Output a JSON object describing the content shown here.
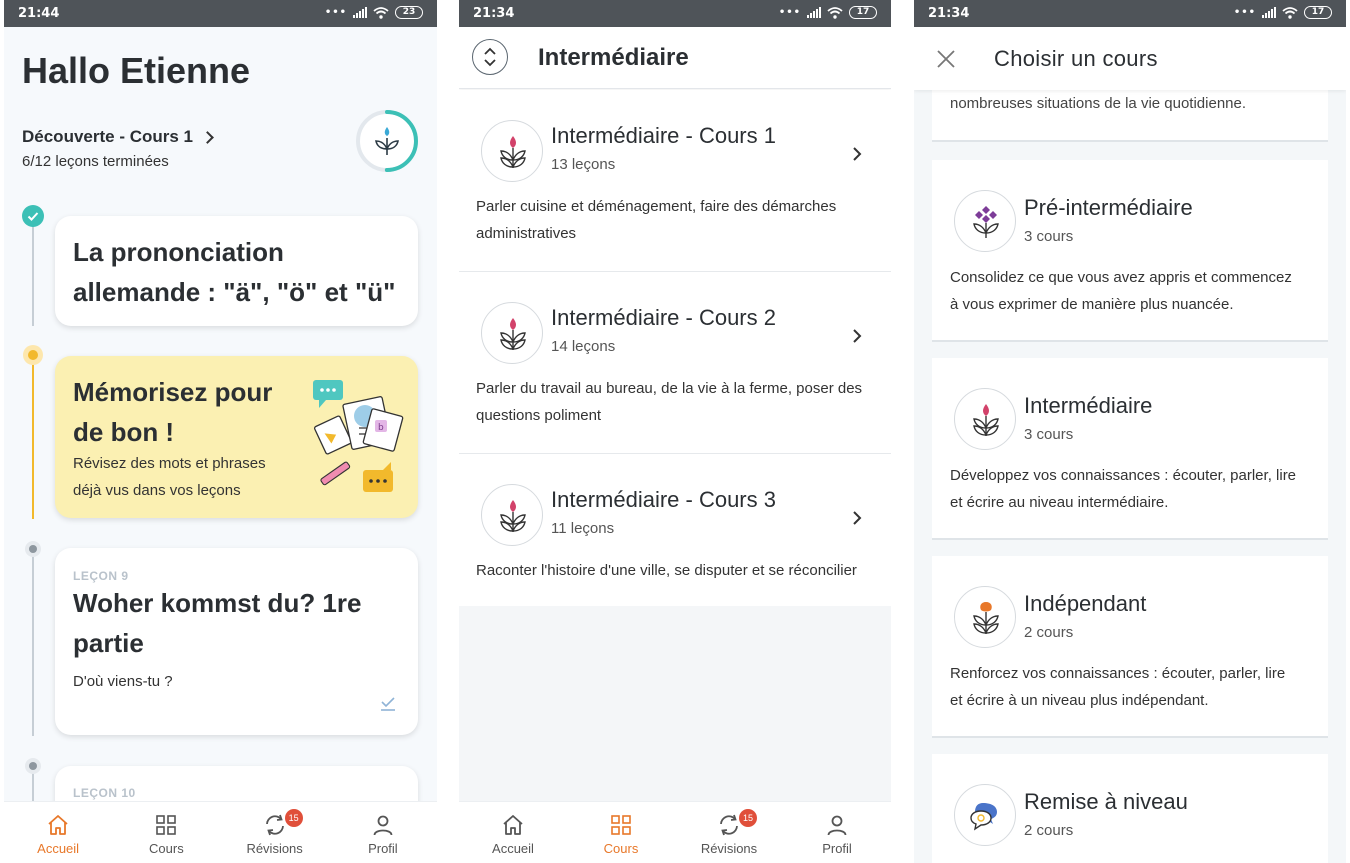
{
  "screen1": {
    "status": {
      "time": "21:44",
      "battery": "23"
    },
    "greeting": "Hallo Etienne",
    "course": {
      "name": "Découverte - Cours 1",
      "progress": "6/12 leçons terminées",
      "fraction": 0.5
    },
    "cards": [
      {
        "title_line1": "La prononciation",
        "title_line2": "allemande : \"ä\", \"ö\" et \"ü\""
      },
      {
        "title_line1": "Mémorisez pour",
        "title_line2": "de bon !",
        "sub_line1": "Révisez des mots et phrases",
        "sub_line2": "déjà vus dans vos leçons"
      },
      {
        "kicker": "LEÇON 9",
        "title_line1": "Woher kommst du? 1re",
        "title_line2": "partie",
        "sub": "D'où viens-tu ?"
      },
      {
        "kicker": "LEÇON 10"
      }
    ]
  },
  "screen2": {
    "status": {
      "time": "21:34",
      "battery": "17"
    },
    "title": "Intermédiaire",
    "courses": [
      {
        "title": "Intermédiaire - Cours 1",
        "count": "13 leçons",
        "desc_line1": "Parler cuisine et déménagement, faire des démarches",
        "desc_line2": "administratives"
      },
      {
        "title": "Intermédiaire - Cours 2",
        "count": "14 leçons",
        "desc_line1": "Parler du travail au bureau, de la vie à la ferme, poser des",
        "desc_line2": "questions poliment"
      },
      {
        "title": "Intermédiaire - Cours 3",
        "count": "11 leçons",
        "desc_line1": "Raconter l'histoire d'une ville, se disputer et se réconcilier",
        "desc_line2": ""
      }
    ]
  },
  "screen3": {
    "status": {
      "time": "21:34",
      "battery": "17"
    },
    "title": "Choisir un cours",
    "prev_tail": "nombreuses situations de la vie quotidienne.",
    "levels": [
      {
        "title": "Pré-intermédiaire",
        "count": "3 cours",
        "desc_line1": "Consolidez ce que vous avez appris et commencez",
        "desc_line2": "à vous exprimer de manière plus nuancée."
      },
      {
        "title": "Intermédiaire",
        "count": "3 cours",
        "desc_line1": "Développez vos connaissances : écouter, parler, lire",
        "desc_line2": "et écrire au niveau intermédiaire."
      },
      {
        "title": "Indépendant",
        "count": "2 cours",
        "desc_line1": "Renforcez vos connaissances : écouter, parler, lire",
        "desc_line2": "et écrire à un niveau plus indépendant."
      },
      {
        "title": "Remise à niveau",
        "count": "2 cours"
      }
    ]
  },
  "nav": {
    "home": "Accueil",
    "courses": "Cours",
    "reviews": "Révisions",
    "profile": "Profil",
    "badge": "15"
  },
  "colors": {
    "accent_orange": "#e8782a",
    "teal": "#3cc0b6",
    "yellow_card": "#fbf0b2",
    "status_bar": "#4f5459",
    "badge_red": "#e04f3a"
  }
}
